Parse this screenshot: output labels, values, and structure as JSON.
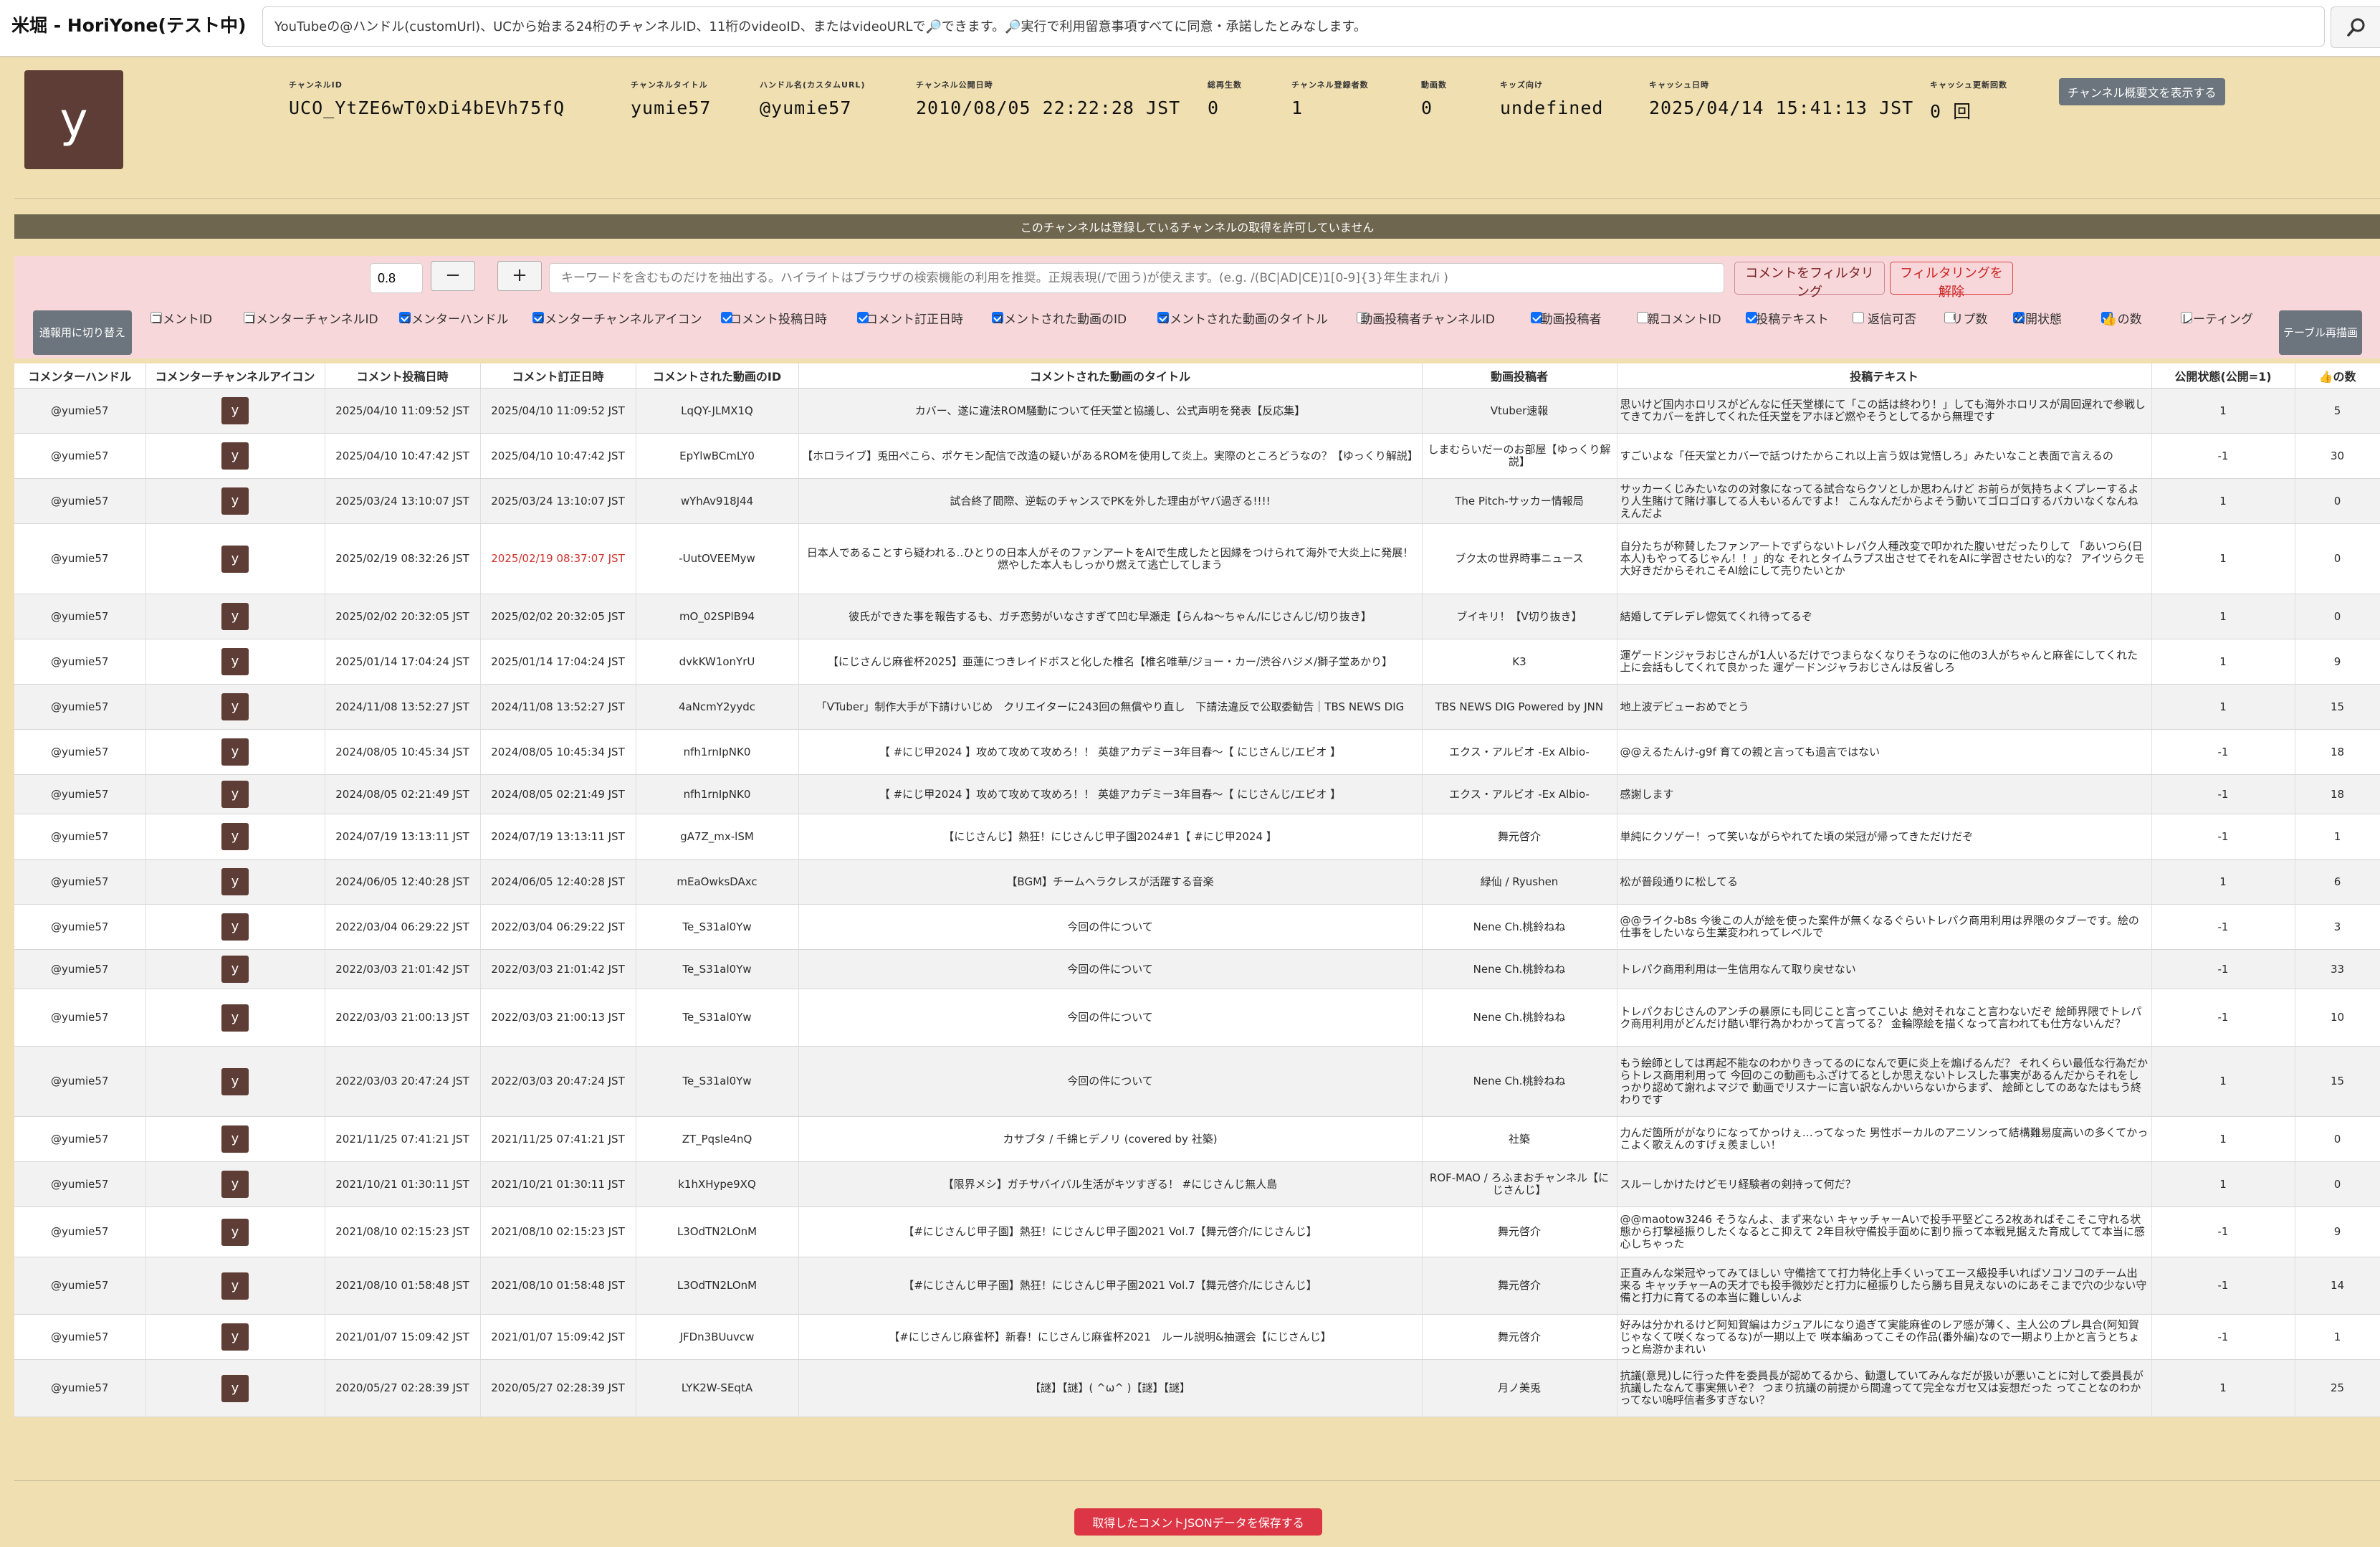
{
  "app": {
    "title": "米堀 - HoriYone(テスト中)"
  },
  "search": {
    "placeholder": "YouTubeの@ハンドル(customUrl)、UCから始まる24桁のチャンネルID、11桁のvideoID、またはvideoURLで🔎できます。🔎実行で利用留意事項すべてに同意・承諾したとみなします。",
    "icon": "search-icon"
  },
  "channel": {
    "icon_letter": "y",
    "fields": [
      {
        "label": "チャンネルID",
        "value": "UCO_YtZE6wT0xDi4bEVh75fQ"
      },
      {
        "label": "チャンネルタイトル",
        "value": "yumie57"
      },
      {
        "label": "ハンドル名(カスタムURL)",
        "value": "@yumie57"
      },
      {
        "label": "チャンネル公開日時",
        "value": "2010/08/05 22:22:28 JST"
      },
      {
        "label": "総再生数",
        "value": "0"
      },
      {
        "label": "チャンネル登録者数",
        "value": "1"
      },
      {
        "label": "動画数",
        "value": "0"
      },
      {
        "label": "キッズ向け",
        "value": "undefined"
      },
      {
        "label": "キャッシュ日時",
        "value": "2025/04/14 15:41:13 JST"
      },
      {
        "label": "キャッシュ更新回数",
        "value": "0 回"
      }
    ],
    "show_description_label": "チャンネル概要文を表示する"
  },
  "notice": "このチャンネルは登録しているチャンネルの取得を許可していません",
  "filter": {
    "threshold": "0.8",
    "minus_label": "−",
    "plus_label": "+",
    "keyword_placeholder": "キーワードを含むものだけを抽出する。ハイライトはブラウザの検索機能の利用を推奨。正規表現(/で囲う)が使えます。(e.g. /(BC|AD|CE)1[0-9]{3}年生まれ/i )",
    "apply_label": "コメントをフィルタリング",
    "clear_label": "フィルタリングを解除",
    "switch_label": "通報用に切り替え",
    "redraw_label": "テーブル再描画",
    "columns": [
      {
        "label": "コメントID",
        "checked": false
      },
      {
        "label": "コメンターチャンネルID",
        "checked": false
      },
      {
        "label": "コメンターハンドル",
        "checked": true
      },
      {
        "label": "コメンターチャンネルアイコン",
        "checked": true
      },
      {
        "label": "コメント投稿日時",
        "checked": true
      },
      {
        "label": "コメント訂正日時",
        "checked": true
      },
      {
        "label": "コメントされた動画のID",
        "checked": true
      },
      {
        "label": "コメントされた動画のタイトル",
        "checked": true
      },
      {
        "label": "動画投稿者チャンネルID",
        "checked": false
      },
      {
        "label": "動画投稿者",
        "checked": true
      },
      {
        "label": "親コメントID",
        "checked": false
      },
      {
        "label": "投稿テキスト",
        "checked": true
      },
      {
        "label": "返信可否",
        "checked": false
      },
      {
        "label": "リプ数",
        "checked": false
      },
      {
        "label": "公開状態",
        "checked": true
      },
      {
        "label": "👍の数",
        "checked": true
      },
      {
        "label": "レーティング",
        "checked": false
      }
    ]
  },
  "table": {
    "headers": [
      "コメンターハンドル",
      "コメンターチャンネルアイコン",
      "コメント投稿日時",
      "コメント訂正日時",
      "コメントされた動画のID",
      "コメントされた動画のタイトル",
      "動画投稿者",
      "投稿テキスト",
      "公開状態(公開=1)",
      "👍の数"
    ],
    "rows": [
      {
        "handle": "@yumie57",
        "icon": "y",
        "posted": "2025/04/10 11:09:52 JST",
        "edited": "2025/04/10 11:09:52 JST",
        "edited_changed": false,
        "video_id": "LqQY-JLMX1Q",
        "title": "カバー、遂に違法ROM騒動について任天堂と協議し、公式声明を発表【反応集】",
        "owner": "Vtuber速報",
        "text": "思いけど国内ホロリスがどんなに任天堂様にて「この話は終わり！」しても海外ホロリスが周回遅れで参戦してきてカバーを許してくれた任天堂をアホほど燃やそうとしてるから無理です",
        "status": "1",
        "likes": "5"
      },
      {
        "handle": "@yumie57",
        "icon": "y",
        "posted": "2025/04/10 10:47:42 JST",
        "edited": "2025/04/10 10:47:42 JST",
        "edited_changed": false,
        "video_id": "EpYlwBCmLY0",
        "title": "【ホロライブ】兎田ぺこら、ポケモン配信で改造の疑いがあるROMを使用して炎上。実際のところどうなの？【ゆっくり解説】",
        "owner": "しまむらいだーのお部屋【ゆっくり解説】",
        "text": "すごいよな「任天堂とカバーで話つけたからこれ以上言う奴は覚悟しろ」みたいなこと表面で言えるの",
        "status": "-1",
        "likes": "30"
      },
      {
        "handle": "@yumie57",
        "icon": "y",
        "posted": "2025/03/24 13:10:07 JST",
        "edited": "2025/03/24 13:10:07 JST",
        "edited_changed": false,
        "video_id": "wYhAv918J44",
        "title": "試合終了間際、逆転のチャンスでPKを外した理由がヤバ過ぎる!!!!",
        "owner": "The Pitch-サッカー情報局",
        "text": "サッカーくじみたいなのの対象になってる試合ならクソとしか思わんけど お前らが気持ちよくプレーするより人生賭けて賭け事してる人もいるんですよ！ こんなんだからよそう動いてゴロゴロするバカいなくなんねえんだよ",
        "status": "1",
        "likes": "0"
      },
      {
        "handle": "@yumie57",
        "icon": "y",
        "posted": "2025/02/19 08:32:26 JST",
        "edited": "2025/02/19 08:37:07 JST",
        "edited_changed": true,
        "video_id": "-UutOVEEMyw",
        "title": "日本人であることすら疑われる‥ひとりの日本人がそのファンアートをAIで生成したと因縁をつけられて海外で大炎上に発展！燃やした本人もしっかり燃えて逃亡してしまう",
        "owner": "ブク太の世界時事ニュース",
        "text": "自分たちが称賛したファンアートでずらないトレパク人種改変で叩かれた腹いせだったりして 「あいつら(日本人)もやってるじゃん！！」的な それとタイムラプス出させてそれをAIに学習させたい的な？ アイツらクモ大好きだからそれこそAI絵にして売りたいとか",
        "status": "1",
        "likes": "0"
      },
      {
        "handle": "@yumie57",
        "icon": "y",
        "posted": "2025/02/02 20:32:05 JST",
        "edited": "2025/02/02 20:32:05 JST",
        "edited_changed": false,
        "video_id": "mO_02SPlB94",
        "title": "彼氏ができた事を報告するも、ガチ恋勢がいなさすぎて凹む早瀬走【らんね〜ちゃん/にじさんじ/切り抜き】",
        "owner": "ブイキリ！【V切り抜き】",
        "text": "結婚してデレデレ惚気てくれ待ってるぞ",
        "status": "1",
        "likes": "0"
      },
      {
        "handle": "@yumie57",
        "icon": "y",
        "posted": "2025/01/14 17:04:24 JST",
        "edited": "2025/01/14 17:04:24 JST",
        "edited_changed": false,
        "video_id": "dvkKW1onYrU",
        "title": "【にじさんじ麻雀杯2025】亜蓮につきレイドボスと化した椎名【椎名唯華/ジョー・カー/渋谷ハジメ/獅子堂あかり】",
        "owner": "K3",
        "text": "運ゲードンジャラおじさんが1人いるだけでつまらなくなりそうなのに他の3人がちゃんと麻雀にしてくれた上に会話もしてくれて良かった 運ゲードンジャラおじさんは反省しろ",
        "status": "1",
        "likes": "9"
      },
      {
        "handle": "@yumie57",
        "icon": "y",
        "posted": "2024/11/08 13:52:27 JST",
        "edited": "2024/11/08 13:52:27 JST",
        "edited_changed": false,
        "video_id": "4aNcmY2yydc",
        "title": "「VTuber」制作大手が下請けいじめ　クリエイターに243回の無償やり直し　下請法違反で公取委勧告｜TBS NEWS DIG",
        "owner": "TBS NEWS DIG Powered by JNN",
        "text": "地上波デビューおめでとう",
        "status": "1",
        "likes": "15"
      },
      {
        "handle": "@yumie57",
        "icon": "y",
        "posted": "2024/08/05 10:45:34 JST",
        "edited": "2024/08/05 10:45:34 JST",
        "edited_changed": false,
        "video_id": "nfh1rnIpNK0",
        "title": "【 #にじ甲2024 】攻めて攻めて攻めろ！！ 英雄アカデミー3年目春〜【 にじさんじ/エビオ 】",
        "owner": "エクス・アルビオ -Ex Albio-",
        "text": "@@えるたんけ-g9f 育ての親と言っても過言ではない",
        "status": "-1",
        "likes": "18"
      },
      {
        "handle": "@yumie57",
        "icon": "y",
        "posted": "2024/08/05 02:21:49 JST",
        "edited": "2024/08/05 02:21:49 JST",
        "edited_changed": false,
        "video_id": "nfh1rnIpNK0",
        "title": "【 #にじ甲2024 】攻めて攻めて攻めろ！！ 英雄アカデミー3年目春〜【 にじさんじ/エビオ 】",
        "owner": "エクス・アルビオ -Ex Albio-",
        "text": "感謝します",
        "status": "-1",
        "likes": "18"
      },
      {
        "handle": "@yumie57",
        "icon": "y",
        "posted": "2024/07/19 13:13:11 JST",
        "edited": "2024/07/19 13:13:11 JST",
        "edited_changed": false,
        "video_id": "gA7Z_mx-lSM",
        "title": "【にじさんじ】熱狂！にじさんじ甲子園2024#1【 #にじ甲2024 】",
        "owner": "舞元啓介",
        "text": "単純にクソゲー！って笑いながらやれてた頃の栄冠が帰ってきただけだぞ",
        "status": "-1",
        "likes": "1"
      },
      {
        "handle": "@yumie57",
        "icon": "y",
        "posted": "2024/06/05 12:40:28 JST",
        "edited": "2024/06/05 12:40:28 JST",
        "edited_changed": false,
        "video_id": "mEaOwksDAxc",
        "title": "【BGM】チームヘラクレスが活躍する音楽",
        "owner": "緑仙 / Ryushen",
        "text": "松が普段通りに松してる",
        "status": "1",
        "likes": "6"
      },
      {
        "handle": "@yumie57",
        "icon": "y",
        "posted": "2022/03/04 06:29:22 JST",
        "edited": "2022/03/04 06:29:22 JST",
        "edited_changed": false,
        "video_id": "Te_S31al0Yw",
        "title": "今回の件について",
        "owner": "Nene Ch.桃鈴ねね",
        "text": "@@ライク-b8s 今後この人が絵を使った案件が無くなるぐらいトレパク商用利用は界隈のタブーです。絵の仕事をしたいなら生業変われってレベルで",
        "status": "-1",
        "likes": "3"
      },
      {
        "handle": "@yumie57",
        "icon": "y",
        "posted": "2022/03/03 21:01:42 JST",
        "edited": "2022/03/03 21:01:42 JST",
        "edited_changed": false,
        "video_id": "Te_S31al0Yw",
        "title": "今回の件について",
        "owner": "Nene Ch.桃鈴ねね",
        "text": "トレパク商用利用は一生信用なんて取り戻せない",
        "status": "-1",
        "likes": "33"
      },
      {
        "handle": "@yumie57",
        "icon": "y",
        "posted": "2022/03/03 21:00:13 JST",
        "edited": "2022/03/03 21:00:13 JST",
        "edited_changed": false,
        "video_id": "Te_S31al0Yw",
        "title": "今回の件について",
        "owner": "Nene Ch.桃鈴ねね",
        "text": "トレパクおじさんのアンチの暴原にも同じこと言ってこいよ 絶対それなこと言わないだぞ 絵師界隈でトレパク商用利用がどんだけ酷い罪行為かわかって言ってる？ 金輪際絵を描くなって言われても仕方ないんだ？",
        "status": "-1",
        "likes": "10"
      },
      {
        "handle": "@yumie57",
        "icon": "y",
        "posted": "2022/03/03 20:47:24 JST",
        "edited": "2022/03/03 20:47:24 JST",
        "edited_changed": false,
        "video_id": "Te_S31al0Yw",
        "title": "今回の件について",
        "owner": "Nene Ch.桃鈴ねね",
        "text": "もう絵師としては再起不能なのわかりきってるのになんで更に炎上を煽げるんだ？ それくらい最低な行為だからトレス商用利用って 今回のこの動画もふざけてるとしか思えないトレスした事実があるんだからそれをしっかり認めて謝れよマジで 動画でリスナーに言い訳なんかいらないからまず、 絵師としてのあなたはもう終わりです",
        "status": "1",
        "likes": "15"
      },
      {
        "handle": "@yumie57",
        "icon": "y",
        "posted": "2021/11/25 07:41:21 JST",
        "edited": "2021/11/25 07:41:21 JST",
        "edited_changed": false,
        "video_id": "ZT_Pqsle4nQ",
        "title": "カサブタ / 千綿ヒデノリ (covered by 社築)",
        "owner": "社築",
        "text": "力んだ箇所ががなりになってかっけぇ…ってなった 男性ボーカルのアニソンって結構難易度高いの多くてかっこよく歌えんのすげぇ羨ましい！",
        "status": "1",
        "likes": "0"
      },
      {
        "handle": "@yumie57",
        "icon": "y",
        "posted": "2021/10/21 01:30:11 JST",
        "edited": "2021/10/21 01:30:11 JST",
        "edited_changed": false,
        "video_id": "k1hXHype9XQ",
        "title": "【限界メシ】ガチサバイバル生活がキツすぎる！ #にじさんじ無人島",
        "owner": "ROF-MAO / ろふまおチャンネル【にじさんじ】",
        "text": "スルーしかけたけどモリ経験者の剣持って何だ？",
        "status": "1",
        "likes": "0"
      },
      {
        "handle": "@yumie57",
        "icon": "y",
        "posted": "2021/08/10 02:15:23 JST",
        "edited": "2021/08/10 02:15:23 JST",
        "edited_changed": false,
        "video_id": "L3OdTN2LOnM",
        "title": "【#にじさんじ甲子園】熱狂！にじさんじ甲子園2021 Vol.7【舞元啓介/にじさんじ】",
        "owner": "舞元啓介",
        "text": "@@maotow3246 そうなんよ、まず来ない キャッチャーAいで投手平堅どころ2枚あればそこそこ守れる状態から打撃極振りしたくなるとこ抑えて 2年目秋守備投手面めに割り振って本戦見据えた育成してて本当に感心しちゃった",
        "status": "-1",
        "likes": "9"
      },
      {
        "handle": "@yumie57",
        "icon": "y",
        "posted": "2021/08/10 01:58:48 JST",
        "edited": "2021/08/10 01:58:48 JST",
        "edited_changed": false,
        "video_id": "L3OdTN2LOnM",
        "title": "【#にじさんじ甲子園】熱狂！にじさんじ甲子園2021 Vol.7【舞元啓介/にじさんじ】",
        "owner": "舞元啓介",
        "text": "正直みんな栄冠やってみてほしい 守備捨てて打力特化上手くいってエース級投手いればソコソコのチーム出来る キャッチャーAの天才でも投手微妙だと打力に極振りしたら勝ち目見えないのにあそこまで穴の少ない守備と打力に育てるの本当に難しいんよ",
        "status": "-1",
        "likes": "14"
      },
      {
        "handle": "@yumie57",
        "icon": "y",
        "posted": "2021/01/07 15:09:42 JST",
        "edited": "2021/01/07 15:09:42 JST",
        "edited_changed": false,
        "video_id": "JFDn3BUuvcw",
        "title": "【#にじさんじ麻雀杯】新春！にじさんじ麻雀杯2021　ルール説明&抽選会【にじさんじ】",
        "owner": "舞元啓介",
        "text": "好みは分かれるけど阿知賀編はカジュアルになり過ぎて実能麻雀のレア感が薄く、主人公のプレ具合(阿知賀じゃなくて咲くなってるな)が一期以上で 咲本編あってこその作品(番外編)なので一期より上かと言うとちょっと烏游かまれい",
        "status": "-1",
        "likes": "1"
      },
      {
        "handle": "@yumie57",
        "icon": "y",
        "posted": "2020/05/27 02:28:39 JST",
        "edited": "2020/05/27 02:28:39 JST",
        "edited_changed": false,
        "video_id": "LYK2W-SEqtA",
        "title": "【謎】【謎】( ^ω^ )【謎】【謎】",
        "owner": "月ノ美兎",
        "text": "抗議(意見)しに行った件を委員長が認めてるから、勧還していてみんなだが扱いが悪いことに対して委員長が抗議したなんて事実無いぞ？ つまり抗議の前提から間違ってて完全なガセ又は妄想だった ってことなのわかってない嗚呼信者多すぎない？",
        "status": "1",
        "likes": "25"
      }
    ]
  },
  "footer": {
    "save_json_label": "取得したコメントJSONデータを保存する"
  },
  "colors": {
    "background": "#efdfb1",
    "channel_icon": "#5d3d35",
    "notice_bar": "#6e664f",
    "filter_panel": "#f8d7da",
    "danger": "#dc3545",
    "edited_highlight": "#d0312d"
  }
}
